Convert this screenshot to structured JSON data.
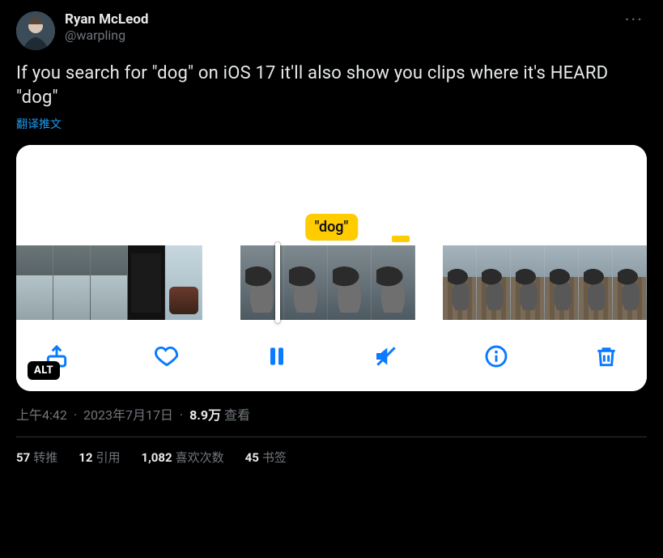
{
  "author": {
    "display_name": "Ryan McLeod",
    "handle": "@warpling"
  },
  "tweet_text": "If you search for \"dog\" on iOS 17 it'll also show you clips where it's HEARD \"dog\"",
  "translate_label": "翻译推文",
  "media": {
    "chip_label": "\"dog\"",
    "alt_badge": "ALT",
    "icons": {
      "share": "share-icon",
      "heart": "heart-icon",
      "pause": "pause-icon",
      "mute": "mute-icon",
      "info": "info-icon",
      "trash": "trash-icon"
    }
  },
  "meta": {
    "time": "上午4:42",
    "date": "2023年7月17日",
    "views_number": "8.9万",
    "views_label": "查看"
  },
  "stats": {
    "retweets": {
      "count": "57",
      "label": "转推"
    },
    "quotes": {
      "count": "12",
      "label": "引用"
    },
    "likes": {
      "count": "1,082",
      "label": "喜欢次数"
    },
    "bookmarks": {
      "count": "45",
      "label": "书签"
    }
  }
}
